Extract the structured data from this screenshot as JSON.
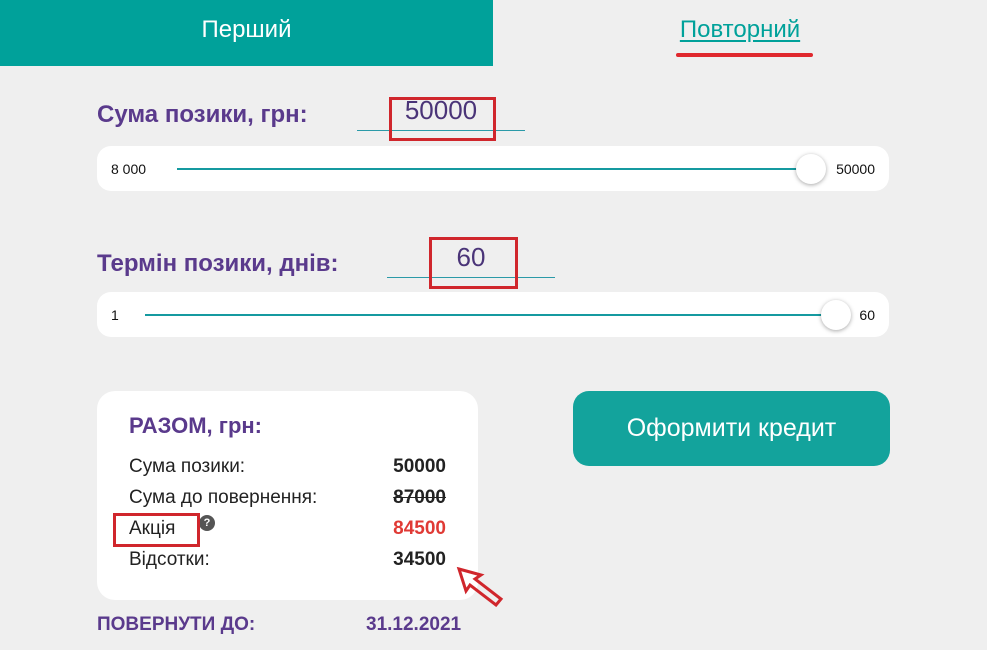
{
  "tabs": {
    "first": "Перший",
    "repeat": "Повторний"
  },
  "amount": {
    "label": "Сума позики, грн:",
    "value": "50000",
    "slider": {
      "min_label": "8 000",
      "max_label": "50000",
      "level": 1.0
    }
  },
  "term": {
    "label": "Термін позики, днів:",
    "value": "60",
    "slider": {
      "min_label": "1",
      "max_label": "60",
      "level": 1.0
    }
  },
  "summary": {
    "title": "РАЗОМ, грн:",
    "rows": [
      {
        "label": "Сума позики:",
        "value": "50000"
      },
      {
        "label": "Сума до повернення:",
        "value": "87000"
      },
      {
        "label": "Акція",
        "value": "84500"
      },
      {
        "label": "Відсотки:",
        "value": "34500"
      }
    ],
    "info_badge": "?"
  },
  "cta": {
    "label": "Оформити кредит"
  },
  "return": {
    "label": "ПОВЕРНУТИ ДО:",
    "date": "31.12.2021"
  },
  "colors": {
    "accent": "#00a19a",
    "brand_purple": "#5a3a8c",
    "annotation_red": "#d0262c",
    "promo_red": "#e03a35"
  },
  "icons": {
    "info": "question-circle-icon",
    "annotation": "arrow-up-left-icon"
  }
}
